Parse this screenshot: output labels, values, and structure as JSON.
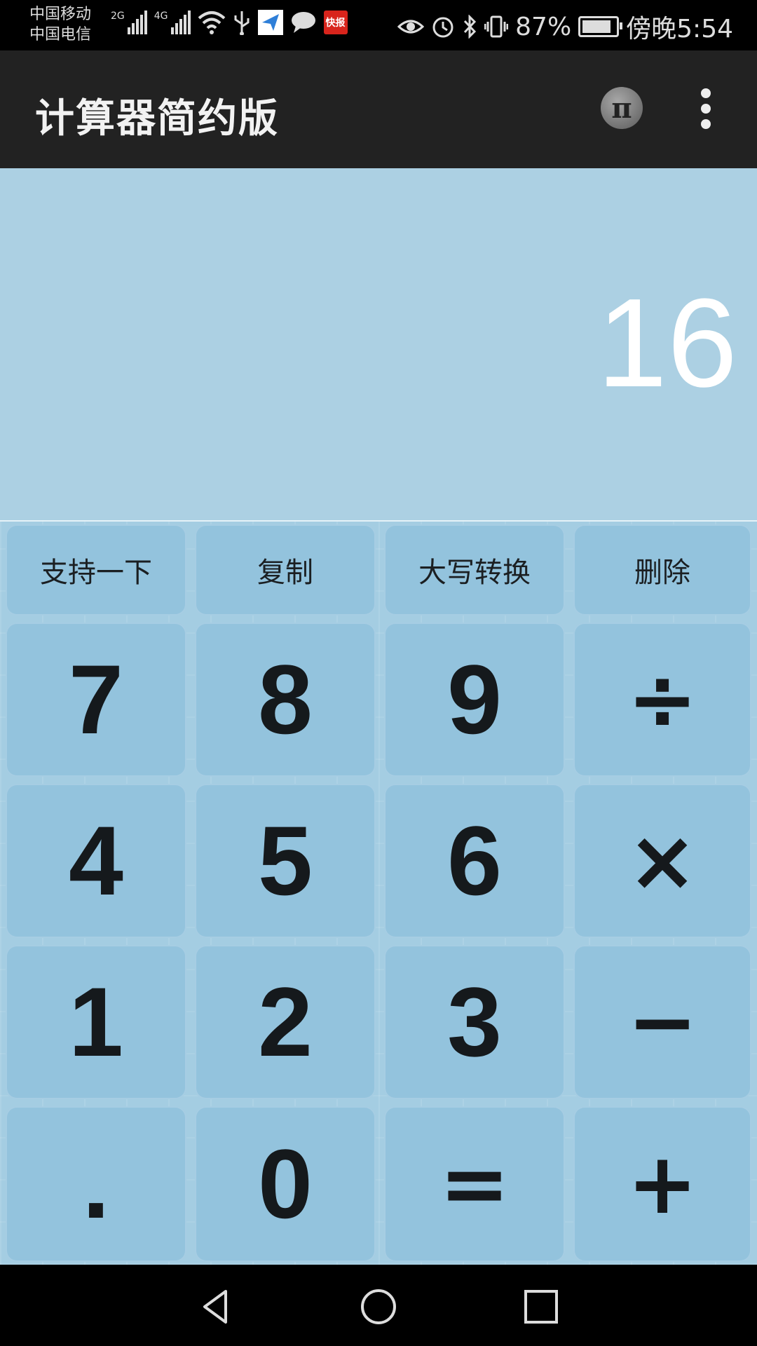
{
  "status_bar": {
    "carrier_1": "中国移动",
    "carrier_2": "中国电信",
    "signal_1_type": "2G",
    "signal_2_type": "4G",
    "notif_app_label": "快报",
    "battery_percent": "87%",
    "battery_level": 0.87,
    "time": "傍晚5:54",
    "icons": [
      "wifi-icon",
      "usb-icon",
      "send-icon",
      "chat-icon",
      "news-icon",
      "eye-icon",
      "alarm-icon",
      "bluetooth-icon",
      "vibrate-icon",
      "battery-icon"
    ]
  },
  "app_bar": {
    "title": "计算器简约版",
    "pi_label": "π"
  },
  "display": {
    "value": "16"
  },
  "keys": {
    "function_row": [
      "支持一下",
      "复制",
      "大写转换",
      "删除"
    ],
    "row1": [
      "7",
      "8",
      "9",
      "÷"
    ],
    "row2": [
      "4",
      "5",
      "6",
      "×"
    ],
    "row3": [
      "1",
      "2",
      "3",
      "−"
    ],
    "row4": [
      ".",
      "0",
      "=",
      "+"
    ]
  },
  "colors": {
    "display_bg": "#acd0e3",
    "key_bg": "#93c3dd",
    "app_bar_bg": "#222222"
  }
}
